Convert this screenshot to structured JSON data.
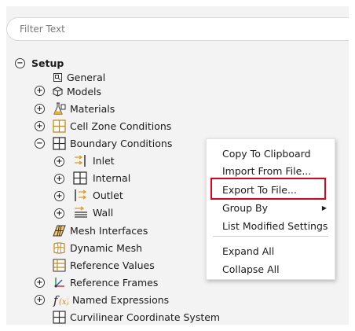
{
  "filter": {
    "placeholder": "Filter Text",
    "value": ""
  },
  "tree": {
    "setup": "Setup",
    "general": "General",
    "models": "Models",
    "materials": "Materials",
    "cell_zone": "Cell Zone Conditions",
    "boundary": "Boundary Conditions",
    "inlet": "Inlet",
    "internal": "Internal",
    "outlet": "Outlet",
    "wall": "Wall",
    "mesh_interfaces": "Mesh Interfaces",
    "dynamic_mesh": "Dynamic Mesh",
    "reference_values": "Reference Values",
    "reference_frames": "Reference Frames",
    "named_expressions": "Named Expressions",
    "curvilinear": "Curvilinear Coordinate System"
  },
  "context_menu": {
    "copy": "Copy To Clipboard",
    "import": "Import From File...",
    "export": "Export To File...",
    "group_by": "Group By",
    "list_modified": "List Modified Settings",
    "expand_all": "Expand All",
    "collapse_all": "Collapse All"
  },
  "colors": {
    "highlight_border": "#e2001a",
    "selection": "#c7d5e6"
  }
}
